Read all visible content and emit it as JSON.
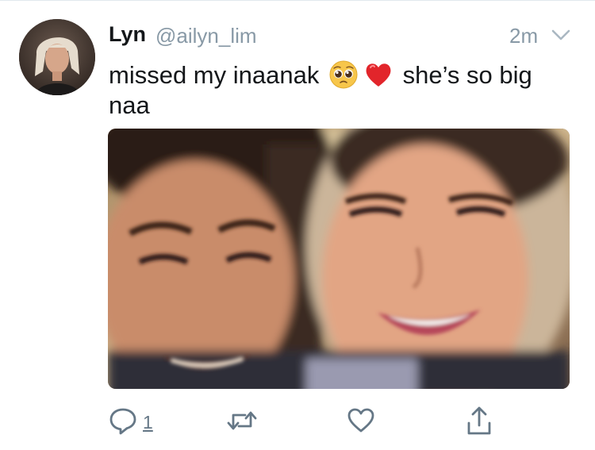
{
  "tweet": {
    "author_name": "Lyn",
    "author_handle": "@ailyn_lim",
    "timestamp": "2m",
    "text_part1": "missed my inaanak",
    "emojis": [
      "pleading-face",
      "red-heart"
    ],
    "text_part2": "she’s so big",
    "text_line2": "naa",
    "reply_count": "1"
  },
  "icons": {
    "caret": "chevron-down-icon",
    "reply": "reply-icon",
    "retweet": "retweet-icon",
    "like": "heart-icon",
    "share": "share-icon"
  },
  "colors": {
    "text_primary": "#14171a",
    "text_secondary": "#8899a6",
    "action_icon": "#657786",
    "divider": "#e1e8ed"
  }
}
